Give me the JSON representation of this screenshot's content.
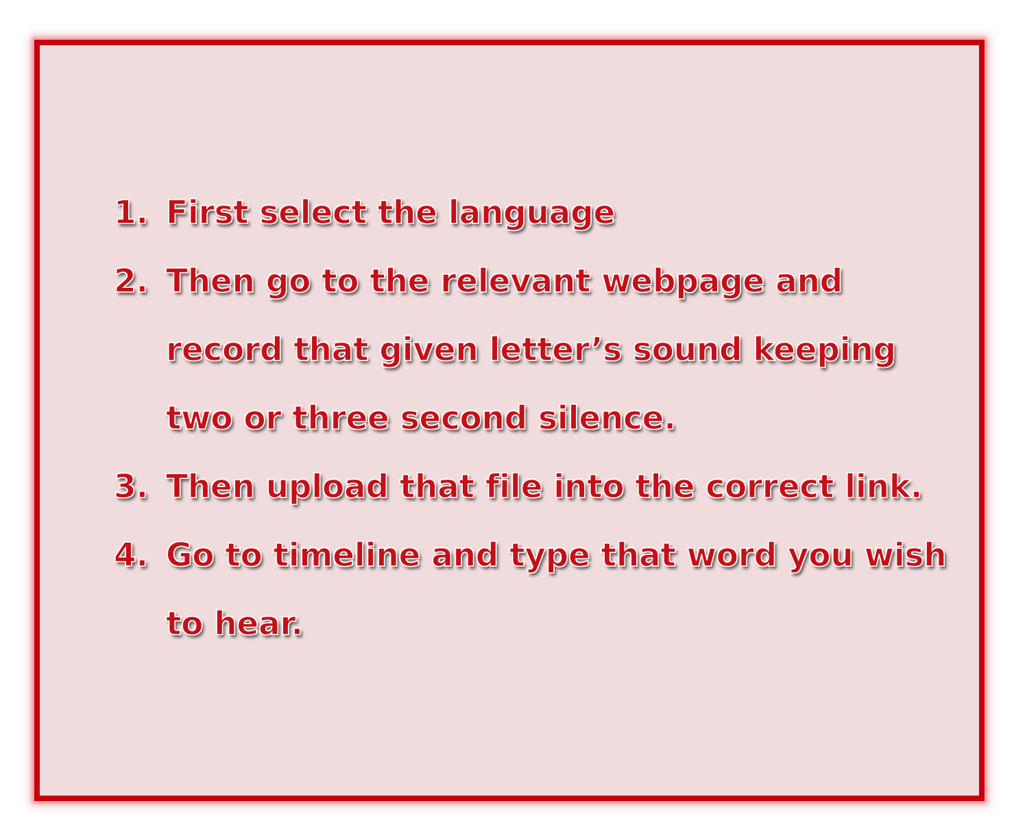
{
  "instructions": {
    "steps": [
      {
        "number": "1.",
        "text": "First select the language"
      },
      {
        "number": "2.",
        "text": "Then go to the relevant webpage and\nrecord that given letter’s sound keeping\ntwo or three second silence."
      },
      {
        "number": "3.",
        "text": "Then upload that file into the correct link."
      },
      {
        "number": "4.",
        "text": "Go to timeline and type that word you wish\nto hear."
      }
    ],
    "colors": {
      "border": "#c8000c",
      "background": "#f1dcdd",
      "text": "#c41018"
    }
  }
}
